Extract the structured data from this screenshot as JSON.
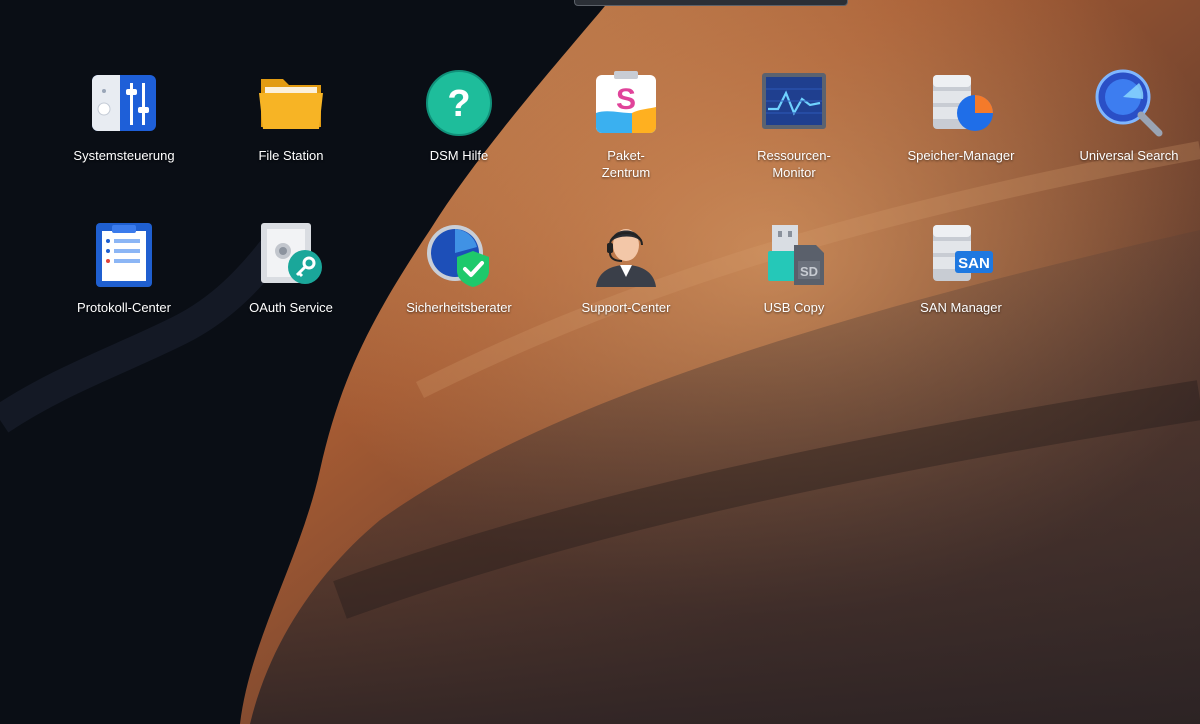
{
  "desktop": {
    "apps": [
      {
        "label": "Systemsteuerung",
        "icon": "control-panel-icon"
      },
      {
        "label": "File Station",
        "icon": "folder-icon"
      },
      {
        "label": "DSM Hilfe",
        "icon": "help-icon"
      },
      {
        "label": "Paket-\nZentrum",
        "icon": "package-center-icon"
      },
      {
        "label": "Ressourcen-\nMonitor",
        "icon": "resource-monitor-icon"
      },
      {
        "label": "Speicher-Manager",
        "icon": "storage-manager-icon"
      },
      {
        "label": "Universal Search",
        "icon": "search-icon"
      },
      {
        "label": "Protokoll-Center",
        "icon": "log-center-icon"
      },
      {
        "label": "OAuth Service",
        "icon": "oauth-safe-icon"
      },
      {
        "label": "Sicherheitsberater",
        "icon": "security-advisor-icon"
      },
      {
        "label": "Support-Center",
        "icon": "support-agent-icon"
      },
      {
        "label": "USB Copy",
        "icon": "usb-copy-icon"
      },
      {
        "label": "SAN Manager",
        "icon": "san-manager-icon"
      }
    ]
  }
}
